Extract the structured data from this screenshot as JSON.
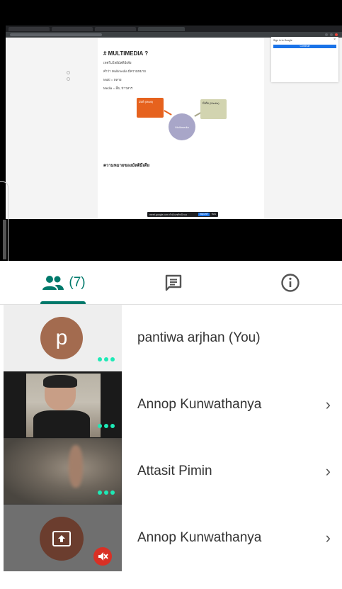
{
  "tabs": {
    "people_count": "(7)",
    "active": "people"
  },
  "participants": [
    {
      "initial": "p",
      "name": "pantiwa arjhan (You)",
      "avatar_color": "#a36b4f"
    },
    {
      "name": "Annop Kunwathanya"
    },
    {
      "name": "Attasit Pimin"
    },
    {
      "name": "Annop Kunwathanya",
      "state": "presenting",
      "muted": true
    }
  ],
  "shared_doc": {
    "heading": "# MULTIMEDIA ?",
    "line_intro": "เทคโนโลยีมัลติมีเดีย",
    "line_meaning": "คำว่า Multimedia มีความหมาย",
    "line_multi": "Multi = หลาย",
    "line_media": "Media = สื่อ, ข่าวสาร",
    "center_label": "Multimedia",
    "box_left": "มัลติ (Multi)",
    "box_right": "มีเดีย (Media)",
    "subheading": "ความหมายของมัลติมีเดีย",
    "share_banner": "meet.google.com กำลังแชร์หน้าจอ",
    "share_stop": "หยุดแชร์",
    "share_hide": "ซ่อน"
  },
  "google_signin": {
    "title": "Sign in to Google",
    "continue": "Continue"
  },
  "colors": {
    "accent": "#00796b",
    "dots": "#1de9b6",
    "mute": "#d93025"
  }
}
